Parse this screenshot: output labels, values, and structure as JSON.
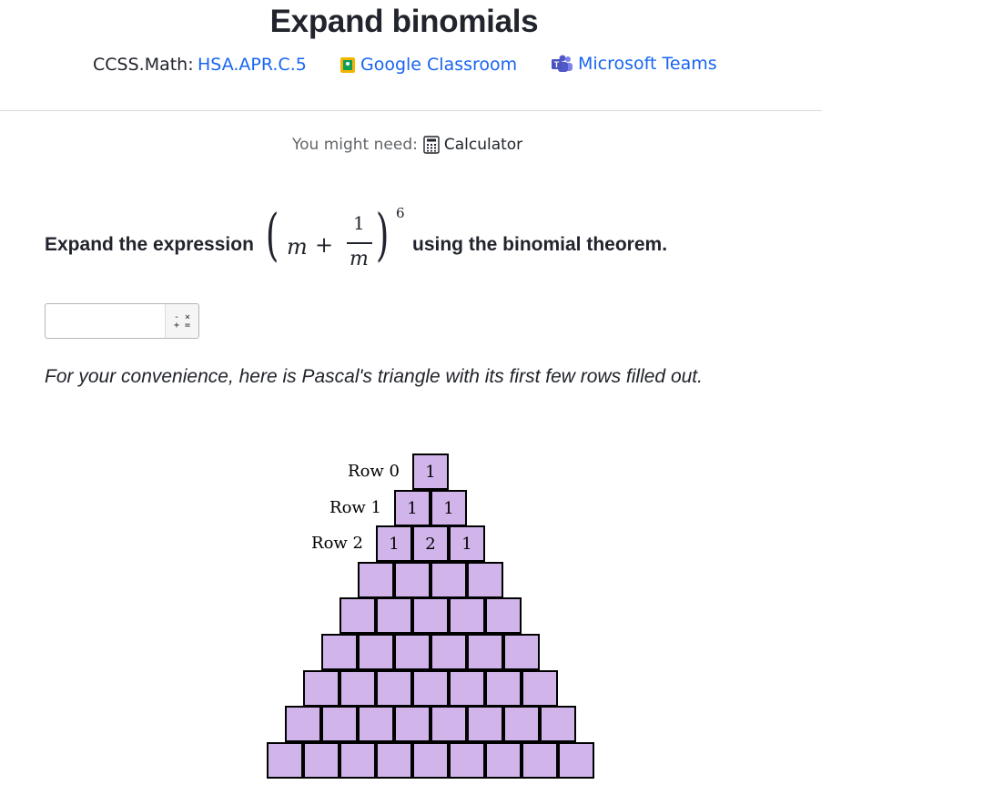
{
  "header": {
    "title": "Expand binomials",
    "ccss_label": "CCSS.Math:",
    "ccss_code": "HSA.APR.C.5",
    "google_classroom": "Google Classroom",
    "microsoft_teams": "Microsoft Teams"
  },
  "tools": {
    "you_might_need": "You might need:",
    "calculator": "Calculator"
  },
  "question": {
    "prefix": "Expand the expression",
    "suffix": "using the binomial theorem.",
    "math": {
      "variable": "m",
      "plus": "+",
      "numerator": "1",
      "denominator": "m",
      "exponent": "6"
    }
  },
  "answer": {
    "value": "",
    "placeholder": "",
    "keypad_top": "- ×",
    "keypad_bottom": "+ ="
  },
  "convenience_text": "For your convenience, here is Pascal's triangle with its first few rows filled out.",
  "pascal": {
    "row_labels": [
      "Row 0",
      "Row 1",
      "Row 2"
    ],
    "filled_rows": [
      [
        "1"
      ],
      [
        "1",
        "1"
      ],
      [
        "1",
        "2",
        "1"
      ]
    ],
    "total_rows": 9,
    "cell_color": "#d1b5ea"
  },
  "colors": {
    "link": "#1865f2",
    "text": "#21242c",
    "muted": "#626569"
  }
}
